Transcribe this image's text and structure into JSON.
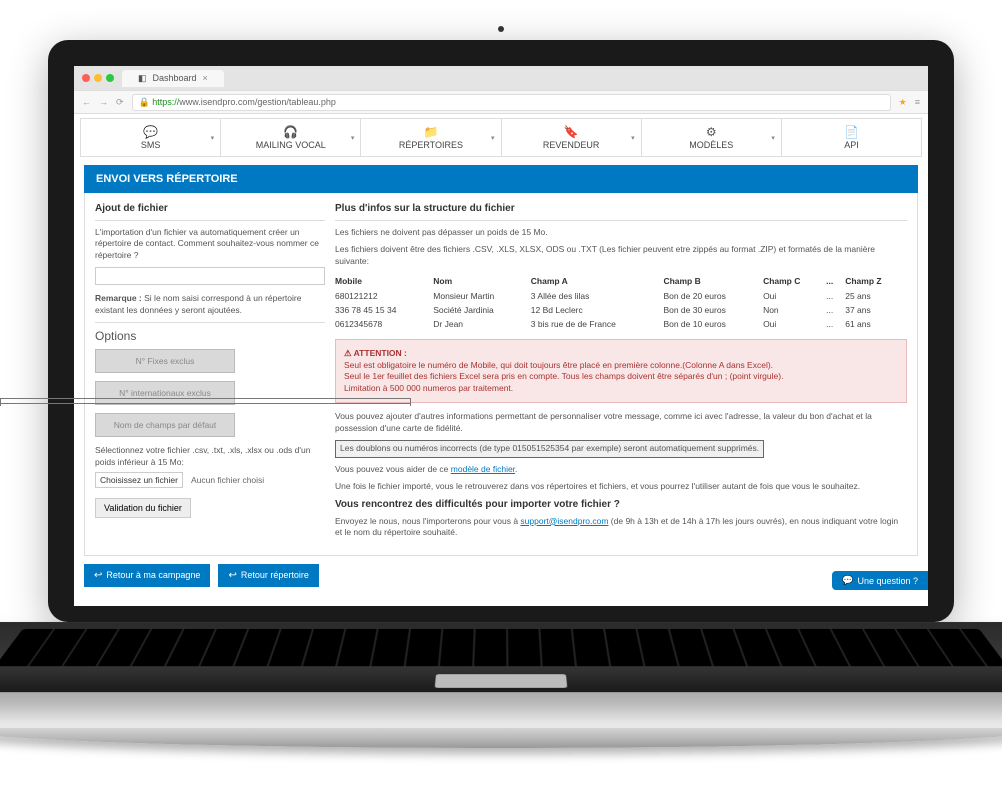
{
  "browser": {
    "tab_title": "Dashboard",
    "url_https": "https://",
    "url_rest": "www.isendpro.com/gestion/tableau.php"
  },
  "nav": [
    {
      "icon": "💬",
      "label": "SMS"
    },
    {
      "icon": "🎧",
      "label": "MAILING VOCAL"
    },
    {
      "icon": "📁",
      "label": "RÉPERTOIRES"
    },
    {
      "icon": "🔖",
      "label": "REVENDEUR"
    },
    {
      "icon": "⚙",
      "label": "MODÈLES"
    },
    {
      "icon": "📄",
      "label": "API"
    }
  ],
  "page_title": "ENVOI VERS RÉPERTOIRE",
  "left": {
    "h_add": "Ajout de fichier",
    "intro": "L'importation d'un fichier va automatiquement créer un répertoire de contact. Comment souhaitez-vous nommer ce répertoire ?",
    "remark_label": "Remarque :",
    "remark_text": "Si le nom saisi correspond à un répertoire existant les données y seront ajoutées.",
    "options_title": "Options",
    "opt1": "N° Fixes exclus",
    "opt2": "N° internationaux exclus",
    "opt3": "Nom de champs par défaut",
    "file_help": "Sélectionnez votre fichier .csv, .txt, .xls, .xlsx ou .ods d'un poids inférieur à 15 Mo:",
    "choose_label": "Choisissez un fichier",
    "file_status": "Aucun fichier choisi",
    "submit": "Validation du fichier"
  },
  "right": {
    "h_info": "Plus d'infos sur la structure du fichier",
    "p1": "Les fichiers ne doivent pas dépasser un poids de 15 Mo.",
    "p2": "Les fichiers doivent être des fichiers .CSV, .XLS, XLSX, ODS ou .TXT (Les fichier peuvent etre zippés au format .ZIP) et formatés de la manière suivante:",
    "table": {
      "headers": [
        "Mobile",
        "Nom",
        "Champ A",
        "Champ B",
        "Champ C",
        "...",
        "Champ Z"
      ],
      "rows": [
        [
          "680121212",
          "Monsieur Martin",
          "3 Allée des lilas",
          "Bon de 20 euros",
          "Oui",
          "...",
          "25 ans"
        ],
        [
          "336 78 45 15 34",
          "Société Jardinia",
          "12 Bd Leclerc",
          "Bon de 30 euros",
          "Non",
          "...",
          "37 ans"
        ],
        [
          "0612345678",
          "Dr Jean",
          "3 bis rue de de France",
          "Bon de 10 euros",
          "Oui",
          "...",
          "61 ans"
        ]
      ]
    },
    "alert_icon": "⚠",
    "alert_title": "ATTENTION :",
    "alert_l1": "Seul est obligatoire le numéro de Mobile, qui doit toujours être placé en première colonne.(Colonne A dans Excel).",
    "alert_l2": "Seul le 1er feuillet des fichiers Excel sera pris en compte. Tous les champs doivent être séparés d'un ; (point virgule).",
    "alert_l3": "Limitation à 500 000 numeros par traitement.",
    "p3a": "Vous pouvez ajouter d'autres informations permettant de personnaliser votre message, comme ici avec l'adresse, la valeur du bon d'achat et la possession d'une carte de fidélité.",
    "p3_highlight": "Les doublons ou numéros incorrects (de type 015051525354 par exemple) seront automatiquement supprimés.",
    "p4a": "Vous pouvez vous aider de ce ",
    "p4_link": "modèle de fichier",
    "p4b": ".",
    "p5": "Une fois le fichier importé, vous le retrouverez dans vos répertoires et fichiers, et vous pourrez l'utiliser autant de fois que vous le souhaitez.",
    "h_trouble": "Vous rencontrez des difficultés pour importer votre fichier ?",
    "p6a": "Envoyez le nous, nous l'importerons pour vous à ",
    "p6_link": "support@isendpro.com",
    "p6b": " (de 9h à 13h et de 14h à 17h les jours ouvrés), en nous indiquant votre login et le nom du répertoire souhaité."
  },
  "bottom": {
    "btn1": "Retour à ma campagne",
    "btn2": "Retour répertoire"
  },
  "question_tab": "Une question ?"
}
